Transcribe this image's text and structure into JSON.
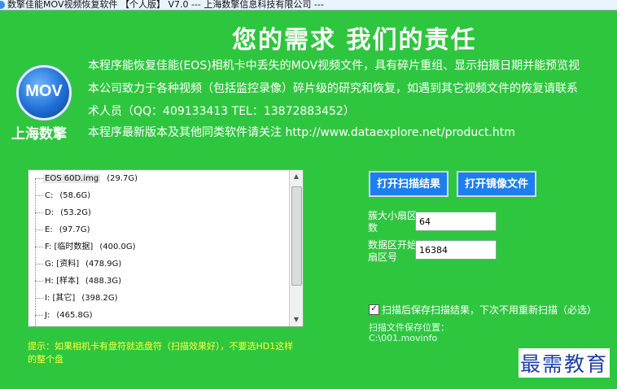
{
  "window": {
    "title": "数擎佳能MOV视频恢复软件 【个人版】 V7.0 --- 上海数擎信息科技有限公司 ---"
  },
  "header": {
    "slogan": "您的需求 我们的责任",
    "logo_text": "MOV",
    "company": "上海数擎",
    "info_lines": [
      "本程序能恢复佳能(EOS)相机卡中丢失的MOV视频文件，具有碎片重组、显示拍摄日期并能预览视",
      "本公司致力于各种视频（包括监控录像）碎片级的研究和恢复，如遇到其它视频文件的恢复请联系",
      "术人员（QQ：409133413 TEL：13872883452）",
      "本程序最新版本及其他同类软件请关注 http://www.dataexplore.net/product.htm"
    ]
  },
  "tree": {
    "items": [
      {
        "label": "EOS 60D.img",
        "size": "(29.7G)"
      },
      {
        "label": "C:",
        "size": "(58.6G)"
      },
      {
        "label": "D:",
        "size": "(53.2G)"
      },
      {
        "label": "E:",
        "size": "(97.7G)"
      },
      {
        "label": "F: [临时数据]",
        "size": "(400.0G)"
      },
      {
        "label": "G: [资料]",
        "size": "(478.9G)"
      },
      {
        "label": "H: [样本]",
        "size": "(488.3G)"
      },
      {
        "label": "I: [其它]",
        "size": "(398.2G)"
      },
      {
        "label": "J:",
        "size": "(465.8G)"
      }
    ]
  },
  "hint": "提示：如果相机卡有盘符就选盘符（扫描效果好），不要选HD1这样的整个盘",
  "buttons": {
    "open_scan_result": "打开扫描结果",
    "open_image_file": "打开镜像文件"
  },
  "fields": {
    "max_sector_label": "簇大小扇区数",
    "max_sector_value": "64",
    "start_sector_label": "数据区开始扇区号",
    "start_sector_value": "16384"
  },
  "options": {
    "save_scan_checked": true,
    "save_scan_label": "扫描后保存扫描结果，下次不用重新扫描（必选）",
    "save_location_label": "扫描文件保存位置：",
    "save_location_value": "C:\\001.movinfo"
  },
  "watermark": "最需教育"
}
